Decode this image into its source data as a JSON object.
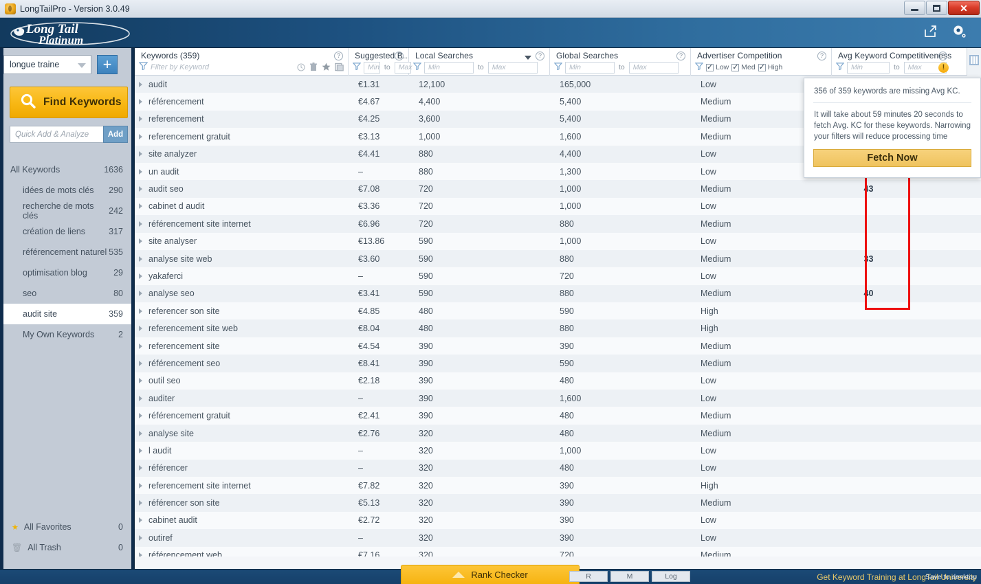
{
  "window": {
    "title": "LongTailPro - Version 3.0.49",
    "app_icon": "flame-icon",
    "minimize": "minimize-icon",
    "maximize": "maximize-icon",
    "close": "close-icon"
  },
  "header": {
    "logo_line1": "Long Tail",
    "logo_line2": "Platinum",
    "export_icon": "export-icon",
    "settings_icon": "gear-icon"
  },
  "sidebar": {
    "project": {
      "value": "longue traine",
      "add_icon": "plus-icon"
    },
    "find_keywords": {
      "label": "Find Keywords",
      "icon": "search-icon"
    },
    "quick_add": {
      "placeholder": "Quick Add & Analyze",
      "button": "Add"
    },
    "items": [
      {
        "label": "All Keywords",
        "count": "1636",
        "level": "root",
        "selected": false
      },
      {
        "label": "idées de mots clés",
        "count": "290",
        "level": "child",
        "selected": false
      },
      {
        "label": "recherche de mots clés",
        "count": "242",
        "level": "child",
        "selected": false
      },
      {
        "label": "création de liens",
        "count": "317",
        "level": "child",
        "selected": false
      },
      {
        "label": "référencement naturel",
        "count": "535",
        "level": "child",
        "selected": false
      },
      {
        "label": "optimisation blog",
        "count": "29",
        "level": "child",
        "selected": false
      },
      {
        "label": "seo",
        "count": "80",
        "level": "child",
        "selected": false
      },
      {
        "label": "audit site",
        "count": "359",
        "level": "child",
        "selected": true
      },
      {
        "label": "My Own Keywords",
        "count": "2",
        "level": "child",
        "selected": false
      }
    ],
    "bottom_items": [
      {
        "label": "All Favorites",
        "count": "0",
        "icon": "star-icon"
      },
      {
        "label": "All Trash",
        "count": "0",
        "icon": "trash-icon"
      }
    ]
  },
  "table": {
    "columns": [
      {
        "key": "keyword",
        "title": "Keywords (359)",
        "help": "?",
        "filter_placeholder": "Filter by Keyword",
        "action_icons": [
          "clock-icon",
          "trash-icon",
          "star-icon",
          "copy-icon"
        ]
      },
      {
        "key": "bid",
        "title": "Suggested B...",
        "help": "?",
        "min_placeholder": "Min",
        "to_label": "to",
        "max_placeholder": "Max"
      },
      {
        "key": "local",
        "title": "Local Searches",
        "help": "?",
        "sorted": true,
        "min_placeholder": "Min",
        "to_label": "to",
        "max_placeholder": "Max"
      },
      {
        "key": "global",
        "title": "Global Searches",
        "help": "?",
        "min_placeholder": "Min",
        "to_label": "to",
        "max_placeholder": "Max"
      },
      {
        "key": "advertiser",
        "title": "Advertiser Competition",
        "help": "?",
        "checkboxes": [
          {
            "label": "Low",
            "checked": true
          },
          {
            "label": "Med",
            "checked": true
          },
          {
            "label": "High",
            "checked": true
          }
        ]
      },
      {
        "key": "avgkc",
        "title": "Avg Keyword Competitiveness",
        "help": "?",
        "min_placeholder": "Min",
        "to_label": "to",
        "max_placeholder": "Max",
        "warning_badge": "!"
      }
    ],
    "panel_toggle_icon": "columns-icon",
    "rows": [
      {
        "keyword": "audit",
        "bid": "€1.31",
        "local": "12,100",
        "global": "165,000",
        "advertiser": "Low",
        "avgkc": ""
      },
      {
        "keyword": "référencement",
        "bid": "€4.67",
        "local": "4,400",
        "global": "5,400",
        "advertiser": "Medium",
        "avgkc": ""
      },
      {
        "keyword": "referencement",
        "bid": "€4.25",
        "local": "3,600",
        "global": "5,400",
        "advertiser": "Medium",
        "avgkc": ""
      },
      {
        "keyword": "referencement gratuit",
        "bid": "€3.13",
        "local": "1,000",
        "global": "1,600",
        "advertiser": "Medium",
        "avgkc": ""
      },
      {
        "keyword": "site analyzer",
        "bid": "€4.41",
        "local": "880",
        "global": "4,400",
        "advertiser": "Low",
        "avgkc": ""
      },
      {
        "keyword": "un audit",
        "bid": "–",
        "local": "880",
        "global": "1,300",
        "advertiser": "Low",
        "avgkc": ""
      },
      {
        "keyword": "audit seo",
        "bid": "€7.08",
        "local": "720",
        "global": "1,000",
        "advertiser": "Medium",
        "avgkc": "43"
      },
      {
        "keyword": "cabinet d audit",
        "bid": "€3.36",
        "local": "720",
        "global": "1,000",
        "advertiser": "Low",
        "avgkc": ""
      },
      {
        "keyword": "référencement site internet",
        "bid": "€6.96",
        "local": "720",
        "global": "880",
        "advertiser": "Medium",
        "avgkc": ""
      },
      {
        "keyword": "site analyser",
        "bid": "€13.86",
        "local": "590",
        "global": "1,000",
        "advertiser": "Low",
        "avgkc": ""
      },
      {
        "keyword": "analyse site web",
        "bid": "€3.60",
        "local": "590",
        "global": "880",
        "advertiser": "Medium",
        "avgkc": "33"
      },
      {
        "keyword": "yakaferci",
        "bid": "–",
        "local": "590",
        "global": "720",
        "advertiser": "Low",
        "avgkc": ""
      },
      {
        "keyword": "analyse seo",
        "bid": "€3.41",
        "local": "590",
        "global": "880",
        "advertiser": "Medium",
        "avgkc": "40"
      },
      {
        "keyword": "referencer son site",
        "bid": "€4.85",
        "local": "480",
        "global": "590",
        "advertiser": "High",
        "avgkc": ""
      },
      {
        "keyword": "referencement site web",
        "bid": "€8.04",
        "local": "480",
        "global": "880",
        "advertiser": "High",
        "avgkc": ""
      },
      {
        "keyword": "referencement site",
        "bid": "€4.54",
        "local": "390",
        "global": "390",
        "advertiser": "Medium",
        "avgkc": ""
      },
      {
        "keyword": "référencement seo",
        "bid": "€8.41",
        "local": "390",
        "global": "590",
        "advertiser": "Medium",
        "avgkc": ""
      },
      {
        "keyword": "outil seo",
        "bid": "€2.18",
        "local": "390",
        "global": "480",
        "advertiser": "Low",
        "avgkc": ""
      },
      {
        "keyword": "auditer",
        "bid": "–",
        "local": "390",
        "global": "1,600",
        "advertiser": "Low",
        "avgkc": ""
      },
      {
        "keyword": "référencement gratuit",
        "bid": "€2.41",
        "local": "390",
        "global": "480",
        "advertiser": "Medium",
        "avgkc": ""
      },
      {
        "keyword": "analyse site",
        "bid": "€2.76",
        "local": "320",
        "global": "480",
        "advertiser": "Medium",
        "avgkc": ""
      },
      {
        "keyword": "l audit",
        "bid": "–",
        "local": "320",
        "global": "1,000",
        "advertiser": "Low",
        "avgkc": ""
      },
      {
        "keyword": "référencer",
        "bid": "–",
        "local": "320",
        "global": "480",
        "advertiser": "Low",
        "avgkc": ""
      },
      {
        "keyword": "referencement site internet",
        "bid": "€7.82",
        "local": "320",
        "global": "390",
        "advertiser": "High",
        "avgkc": ""
      },
      {
        "keyword": "référencer son site",
        "bid": "€5.13",
        "local": "320",
        "global": "390",
        "advertiser": "Medium",
        "avgkc": ""
      },
      {
        "keyword": "cabinet audit",
        "bid": "€2.72",
        "local": "320",
        "global": "390",
        "advertiser": "Low",
        "avgkc": ""
      },
      {
        "keyword": "outiref",
        "bid": "–",
        "local": "320",
        "global": "390",
        "advertiser": "Low",
        "avgkc": ""
      },
      {
        "keyword": "référencement web",
        "bid": "€7.16",
        "local": "320",
        "global": "720",
        "advertiser": "Medium",
        "avgkc": ""
      }
    ]
  },
  "popup": {
    "line1": "356 of 359 keywords are missing Avg KC.",
    "line2": "It will take about 59 minutes 20 seconds to fetch Avg. KC for these keywords.  Narrowing your filters will reduce processing time",
    "button": "Fetch Now"
  },
  "footer": {
    "rank_checker": "Rank Checker",
    "rank_checker_icon": "chevron-up-icon",
    "tabs": [
      "R",
      "M",
      "Log"
    ],
    "promo": "Get Keyword Training at LongTail University",
    "tooltip": "Save to desktop"
  },
  "colors": {
    "accent_yellow": "#f8b713",
    "header_blue": "#1d5180",
    "highlight_red": "#ee1111",
    "sidebar_bg": "#c3cbd6"
  }
}
